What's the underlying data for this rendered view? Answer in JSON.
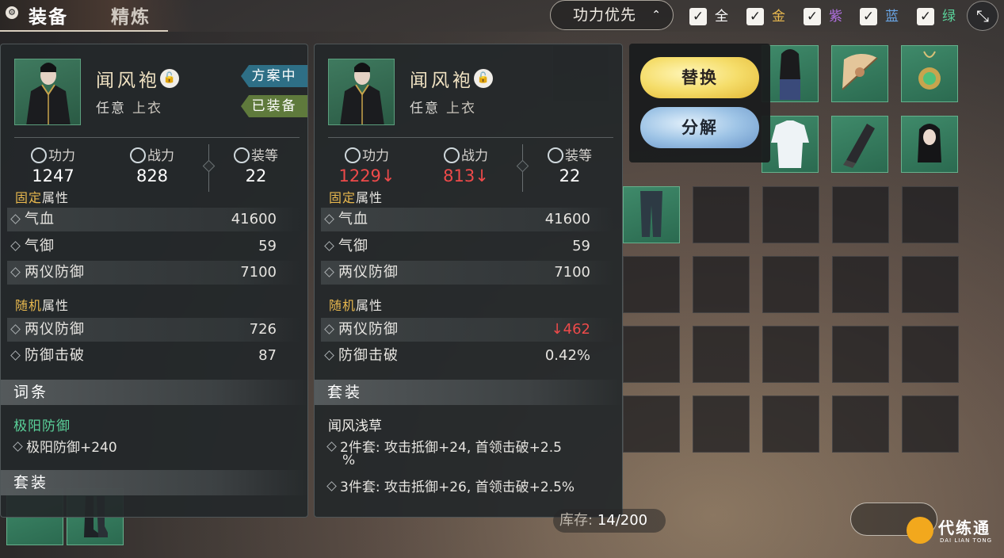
{
  "tabs": {
    "equip": "装备",
    "refine": "精炼"
  },
  "sort": {
    "label": "功力优先"
  },
  "filters": [
    {
      "label": "全",
      "color": "#ffffff",
      "checked": true
    },
    {
      "label": "金",
      "color": "#e8b84e",
      "checked": true
    },
    {
      "label": "紫",
      "color": "#b070e0",
      "checked": true
    },
    {
      "label": "蓝",
      "color": "#6aa6e6",
      "checked": true
    },
    {
      "label": "绿",
      "color": "#5ad29a",
      "checked": true
    }
  ],
  "left_panel": {
    "name": "闻风袍",
    "type": "任意",
    "slot": "上衣",
    "tag_plan": "方案中",
    "tag_equipped": "已装备",
    "stats": {
      "power_label": "功力",
      "power": "1247",
      "combat_label": "战力",
      "combat": "828",
      "level_label": "装等",
      "level": "22"
    },
    "fixed_label_a": "固定",
    "fixed_label_b": "属性",
    "fixed": [
      {
        "name": "气血",
        "value": "41600"
      },
      {
        "name": "气御",
        "value": "59"
      },
      {
        "name": "两仪防御",
        "value": "7100"
      }
    ],
    "random_label_a": "随机",
    "random_label_b": "属性",
    "random": [
      {
        "name": "两仪防御",
        "value": "726"
      },
      {
        "name": "防御击破",
        "value": "87"
      }
    ],
    "affix_header": "词条",
    "affix_title": "极阳防御",
    "affix_line": "极阳防御+240",
    "set_header": "套装"
  },
  "right_panel": {
    "name": "闻风袍",
    "type": "任意",
    "slot": "上衣",
    "stats": {
      "power_label": "功力",
      "power": "1229↓",
      "combat_label": "战力",
      "combat": "813↓",
      "level_label": "装等",
      "level": "22"
    },
    "fixed_label_a": "固定",
    "fixed_label_b": "属性",
    "fixed": [
      {
        "name": "气血",
        "value": "41600"
      },
      {
        "name": "气御",
        "value": "59"
      },
      {
        "name": "两仪防御",
        "value": "7100"
      }
    ],
    "random_label_a": "随机",
    "random_label_b": "属性",
    "random": [
      {
        "name": "两仪防御",
        "value": "↓462"
      },
      {
        "name": "防御击破",
        "value": "0.42%"
      }
    ],
    "set_header": "套装",
    "set_name": "闻风浅草",
    "set_line1": "2件套: 攻击抵御+24, 首领击破+2.5",
    "set_line1b": "%",
    "set_line2": "3件套: 攻击抵御+26, 首领击破+2.5%"
  },
  "actions": {
    "swap": "替换",
    "break": "分解"
  },
  "inventory": {
    "label": "库存:",
    "count": "14/200"
  },
  "watermark": {
    "title": "代练通",
    "sub": "DAI LIAN TONG"
  }
}
